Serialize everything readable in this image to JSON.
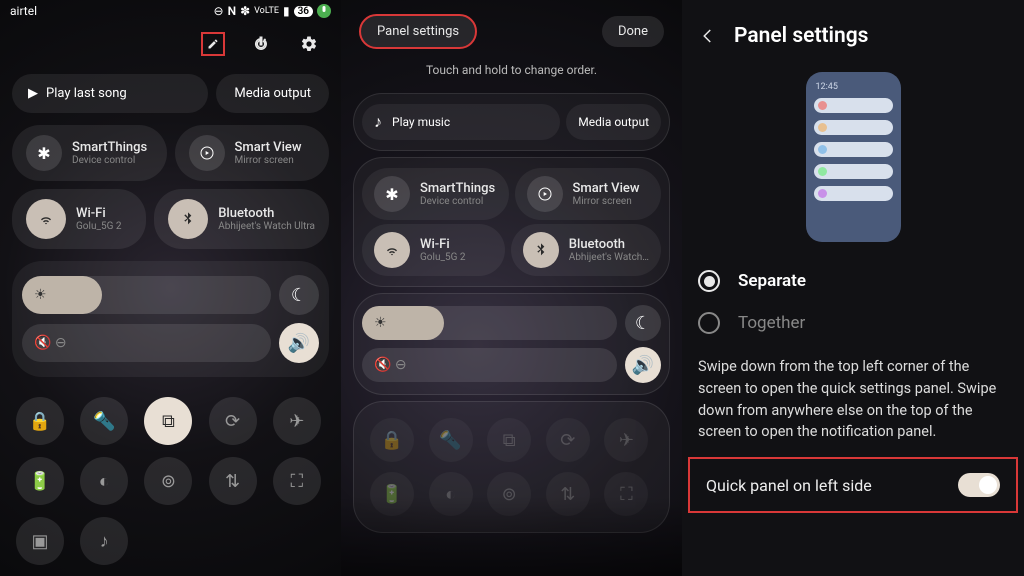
{
  "status": {
    "carrier": "airtel",
    "battery": "36"
  },
  "panel1": {
    "play_last": "Play last song",
    "media_output": "Media output",
    "smartthings": {
      "title": "SmartThings",
      "sub": "Device control"
    },
    "smartview": {
      "title": "Smart View",
      "sub": "Mirror screen"
    },
    "wifi": {
      "title": "Wi-Fi",
      "sub": "Golu_5G 2"
    },
    "bluetooth": {
      "title": "Bluetooth",
      "sub": "Abhijeet's Watch Ultra"
    }
  },
  "panel2": {
    "settings_btn": "Panel settings",
    "done_btn": "Done",
    "hint": "Touch and hold to change order.",
    "play_music": "Play music",
    "media_output": "Media output",
    "smartthings": {
      "title": "SmartThings",
      "sub": "Device control"
    },
    "smartview": {
      "title": "Smart View",
      "sub": "Mirror screen"
    },
    "wifi": {
      "title": "Wi-Fi",
      "sub": "Golu_5G 2"
    },
    "bluetooth": {
      "title": "Bluetooth",
      "sub": "Abhijeet's Watch…"
    }
  },
  "panel3": {
    "title": "Panel settings",
    "preview_time": "12:45",
    "opt_separate": "Separate",
    "opt_together": "Together",
    "desc": "Swipe down from the top left corner of the screen to open the quick settings panel. Swipe down from anywhere else on the top of the screen to open the notification panel.",
    "toggle_label": "Quick panel on left side"
  }
}
